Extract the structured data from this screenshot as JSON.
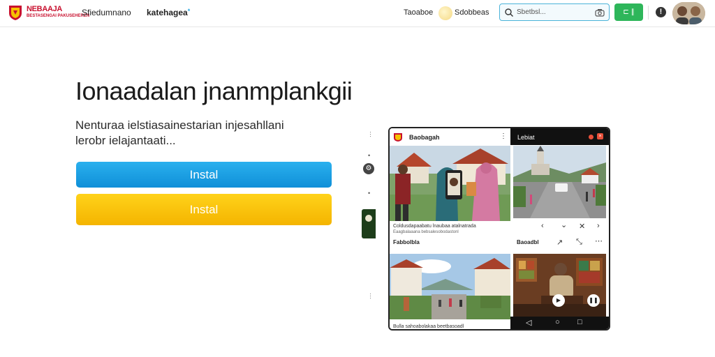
{
  "header": {
    "logo_text": "NEBAAJA",
    "logo_subtext": "BESTASENGAI PAKUSEHEREN",
    "nav": [
      {
        "label": "Sfiedumnano"
      },
      {
        "label": "katehagea",
        "badge": "*"
      }
    ],
    "right_links": [
      {
        "label": "Taoaboe"
      },
      {
        "label": "Sdobbeas"
      }
    ],
    "search": {
      "placeholder": "Sbetbsl..."
    },
    "green_button_label": "⊏ ∥",
    "info_label": "!"
  },
  "hero": {
    "title": "Ionaadalan jnanmplankgii",
    "description": "Nenturaa ielstiasainestarian injesahllani lerobr ielajantaati...",
    "buttons": [
      {
        "label": "Instal",
        "color": "#1aa0e4"
      },
      {
        "label": "Instal",
        "color": "#f8c30a"
      }
    ]
  },
  "side_controls": {
    "top_dots": "···",
    "bottom_dots": "···"
  },
  "device": {
    "left_header": "Baobagah",
    "left_menu": "⋮",
    "right_header": "Lebiat",
    "left_caption_1": "Coldusdapaabatu lnaubaa atalnatrada",
    "left_caption_1b": "Eaagbalaaana bebsalesobodastonl",
    "left_caption_2": "Fabbolbla",
    "left_caption_3": "Bulla sahoabolakaa beetbasoadl",
    "right_caption": "Baoadbl",
    "right_controls": [
      "‹",
      "⌄",
      "✕",
      "›"
    ],
    "nav_buttons": [
      "◁",
      "○",
      "□"
    ]
  },
  "colors": {
    "accent_blue": "#1aa0e4",
    "accent_yellow": "#f8c30a",
    "green": "#2eb65a",
    "brand_red": "#c8102e"
  }
}
